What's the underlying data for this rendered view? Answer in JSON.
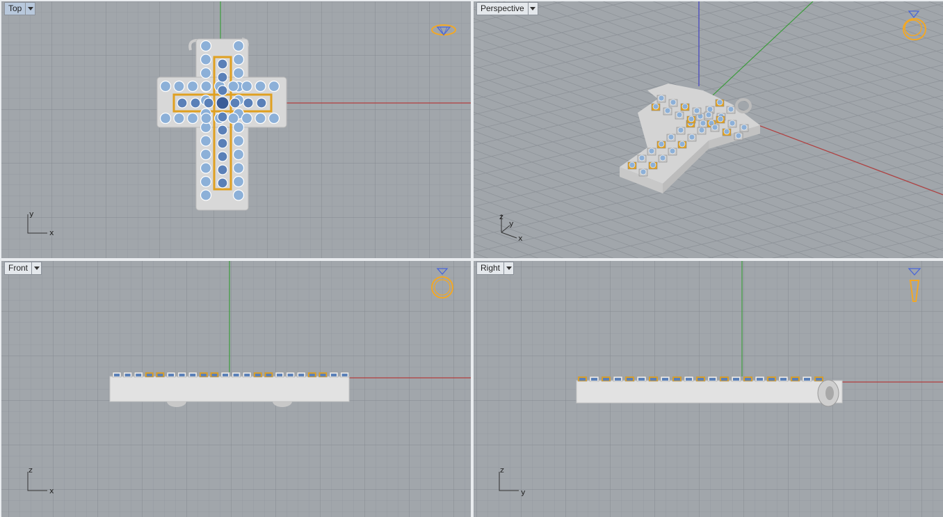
{
  "viewports": [
    {
      "id": "top",
      "tab_label": "Top",
      "active": true,
      "axis_labels": [
        "y",
        "x"
      ]
    },
    {
      "id": "persp",
      "tab_label": "Perspective",
      "active": false,
      "axis_labels": [
        "z",
        "y",
        "x"
      ]
    },
    {
      "id": "front",
      "tab_label": "Front",
      "active": false,
      "axis_labels": [
        "z",
        "x"
      ]
    },
    {
      "id": "right",
      "tab_label": "Right",
      "active": false,
      "axis_labels": [
        "z",
        "y"
      ]
    }
  ],
  "colors": {
    "viewport_bg": "#a1a6ab",
    "grid_minor": "#959aa0",
    "grid_major": "#8a8f95",
    "axis_x": "#b43c3c",
    "axis_y": "#3c9c3c",
    "axis_z": "#4040c0",
    "metal": "#d8d8d8",
    "gold": "#e0a020",
    "stone": "#8cb0d8",
    "ring_icon": "#f2a826",
    "diamond_icon": "#4a66d8"
  },
  "icons": {
    "view_orientation": "ring-diamond-icon",
    "view_menu": "dropdown-arrow-icon"
  }
}
